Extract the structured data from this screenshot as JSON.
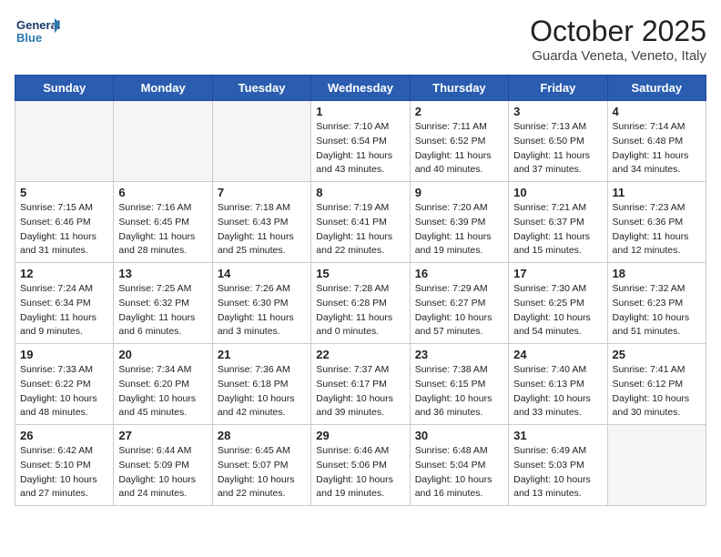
{
  "header": {
    "logo_line1": "General",
    "logo_line2": "Blue",
    "month": "October 2025",
    "location": "Guarda Veneta, Veneto, Italy"
  },
  "weekdays": [
    "Sunday",
    "Monday",
    "Tuesday",
    "Wednesday",
    "Thursday",
    "Friday",
    "Saturday"
  ],
  "weeks": [
    [
      {
        "day": "",
        "info": ""
      },
      {
        "day": "",
        "info": ""
      },
      {
        "day": "",
        "info": ""
      },
      {
        "day": "1",
        "info": "Sunrise: 7:10 AM\nSunset: 6:54 PM\nDaylight: 11 hours\nand 43 minutes."
      },
      {
        "day": "2",
        "info": "Sunrise: 7:11 AM\nSunset: 6:52 PM\nDaylight: 11 hours\nand 40 minutes."
      },
      {
        "day": "3",
        "info": "Sunrise: 7:13 AM\nSunset: 6:50 PM\nDaylight: 11 hours\nand 37 minutes."
      },
      {
        "day": "4",
        "info": "Sunrise: 7:14 AM\nSunset: 6:48 PM\nDaylight: 11 hours\nand 34 minutes."
      }
    ],
    [
      {
        "day": "5",
        "info": "Sunrise: 7:15 AM\nSunset: 6:46 PM\nDaylight: 11 hours\nand 31 minutes."
      },
      {
        "day": "6",
        "info": "Sunrise: 7:16 AM\nSunset: 6:45 PM\nDaylight: 11 hours\nand 28 minutes."
      },
      {
        "day": "7",
        "info": "Sunrise: 7:18 AM\nSunset: 6:43 PM\nDaylight: 11 hours\nand 25 minutes."
      },
      {
        "day": "8",
        "info": "Sunrise: 7:19 AM\nSunset: 6:41 PM\nDaylight: 11 hours\nand 22 minutes."
      },
      {
        "day": "9",
        "info": "Sunrise: 7:20 AM\nSunset: 6:39 PM\nDaylight: 11 hours\nand 19 minutes."
      },
      {
        "day": "10",
        "info": "Sunrise: 7:21 AM\nSunset: 6:37 PM\nDaylight: 11 hours\nand 15 minutes."
      },
      {
        "day": "11",
        "info": "Sunrise: 7:23 AM\nSunset: 6:36 PM\nDaylight: 11 hours\nand 12 minutes."
      }
    ],
    [
      {
        "day": "12",
        "info": "Sunrise: 7:24 AM\nSunset: 6:34 PM\nDaylight: 11 hours\nand 9 minutes."
      },
      {
        "day": "13",
        "info": "Sunrise: 7:25 AM\nSunset: 6:32 PM\nDaylight: 11 hours\nand 6 minutes."
      },
      {
        "day": "14",
        "info": "Sunrise: 7:26 AM\nSunset: 6:30 PM\nDaylight: 11 hours\nand 3 minutes."
      },
      {
        "day": "15",
        "info": "Sunrise: 7:28 AM\nSunset: 6:28 PM\nDaylight: 11 hours\nand 0 minutes."
      },
      {
        "day": "16",
        "info": "Sunrise: 7:29 AM\nSunset: 6:27 PM\nDaylight: 10 hours\nand 57 minutes."
      },
      {
        "day": "17",
        "info": "Sunrise: 7:30 AM\nSunset: 6:25 PM\nDaylight: 10 hours\nand 54 minutes."
      },
      {
        "day": "18",
        "info": "Sunrise: 7:32 AM\nSunset: 6:23 PM\nDaylight: 10 hours\nand 51 minutes."
      }
    ],
    [
      {
        "day": "19",
        "info": "Sunrise: 7:33 AM\nSunset: 6:22 PM\nDaylight: 10 hours\nand 48 minutes."
      },
      {
        "day": "20",
        "info": "Sunrise: 7:34 AM\nSunset: 6:20 PM\nDaylight: 10 hours\nand 45 minutes."
      },
      {
        "day": "21",
        "info": "Sunrise: 7:36 AM\nSunset: 6:18 PM\nDaylight: 10 hours\nand 42 minutes."
      },
      {
        "day": "22",
        "info": "Sunrise: 7:37 AM\nSunset: 6:17 PM\nDaylight: 10 hours\nand 39 minutes."
      },
      {
        "day": "23",
        "info": "Sunrise: 7:38 AM\nSunset: 6:15 PM\nDaylight: 10 hours\nand 36 minutes."
      },
      {
        "day": "24",
        "info": "Sunrise: 7:40 AM\nSunset: 6:13 PM\nDaylight: 10 hours\nand 33 minutes."
      },
      {
        "day": "25",
        "info": "Sunrise: 7:41 AM\nSunset: 6:12 PM\nDaylight: 10 hours\nand 30 minutes."
      }
    ],
    [
      {
        "day": "26",
        "info": "Sunrise: 6:42 AM\nSunset: 5:10 PM\nDaylight: 10 hours\nand 27 minutes."
      },
      {
        "day": "27",
        "info": "Sunrise: 6:44 AM\nSunset: 5:09 PM\nDaylight: 10 hours\nand 24 minutes."
      },
      {
        "day": "28",
        "info": "Sunrise: 6:45 AM\nSunset: 5:07 PM\nDaylight: 10 hours\nand 22 minutes."
      },
      {
        "day": "29",
        "info": "Sunrise: 6:46 AM\nSunset: 5:06 PM\nDaylight: 10 hours\nand 19 minutes."
      },
      {
        "day": "30",
        "info": "Sunrise: 6:48 AM\nSunset: 5:04 PM\nDaylight: 10 hours\nand 16 minutes."
      },
      {
        "day": "31",
        "info": "Sunrise: 6:49 AM\nSunset: 5:03 PM\nDaylight: 10 hours\nand 13 minutes."
      },
      {
        "day": "",
        "info": ""
      }
    ]
  ]
}
